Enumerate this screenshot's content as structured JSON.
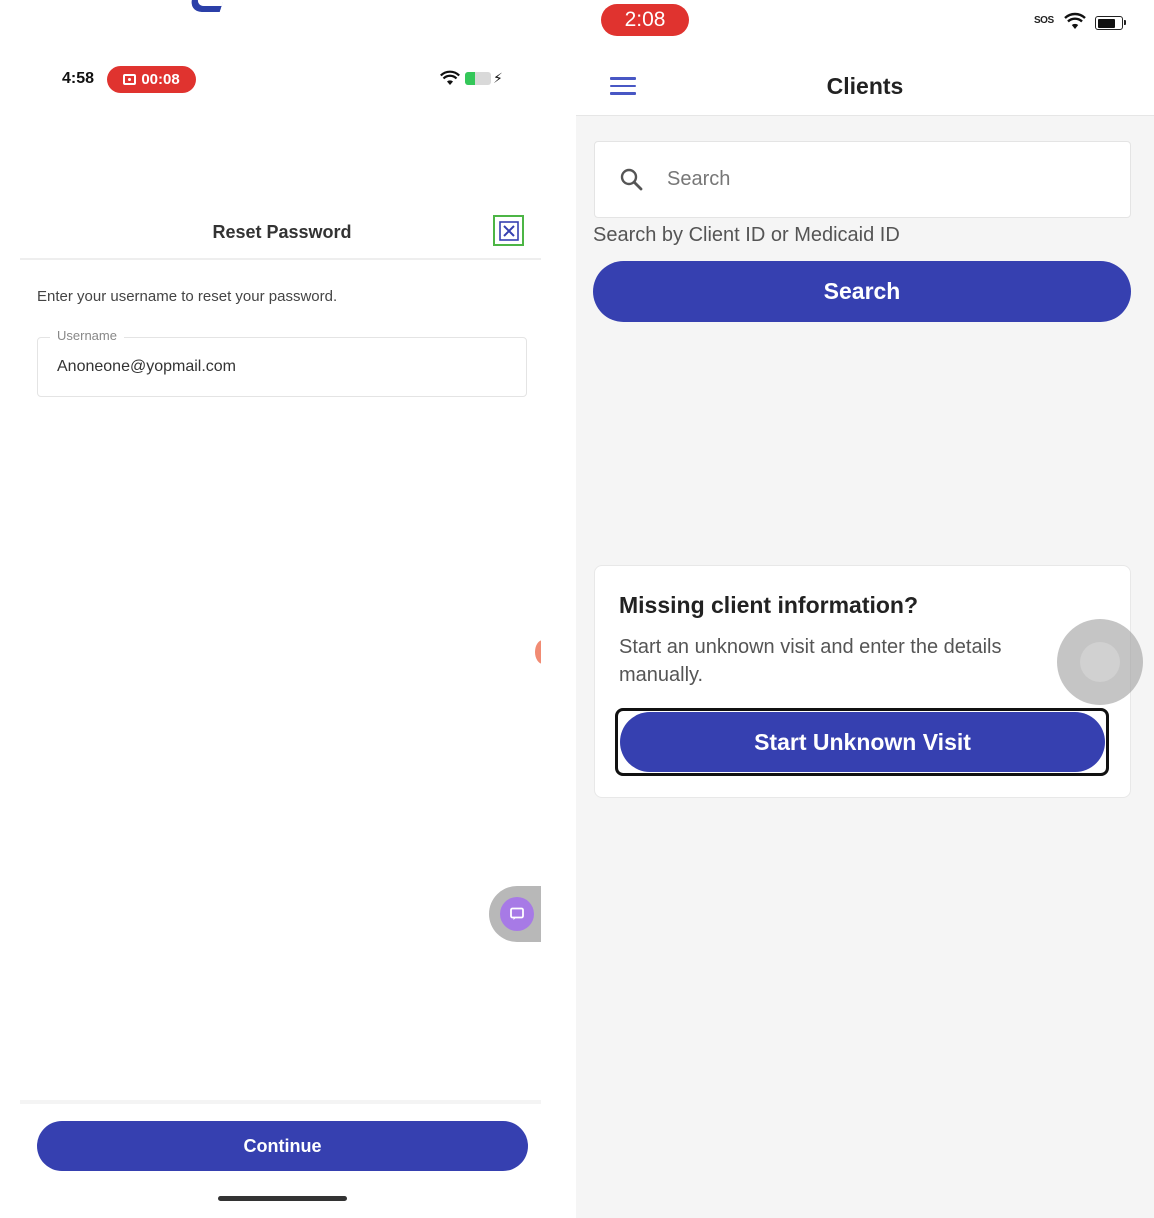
{
  "left_phone": {
    "status_bar": {
      "time": "4:58",
      "recording_time": "00:08"
    },
    "reset_password": {
      "title": "Reset Password",
      "instructions": "Enter your username to reset your password.",
      "username_label": "Username",
      "username_value": "Anoneone@yopmail.com",
      "continue_label": "Continue"
    },
    "colors": {
      "primary": "#3640b0",
      "close_border": "#4cb545",
      "recording": "#e0332f"
    }
  },
  "right_phone": {
    "status_bar": {
      "time": "2:08",
      "sos": "SOS"
    },
    "header": {
      "title": "Clients"
    },
    "search": {
      "placeholder": "Search",
      "hint": "Search by Client ID or Medicaid ID",
      "button_label": "Search"
    },
    "missing_info": {
      "title": "Missing client information?",
      "description": "Start an unknown visit and enter the details manually.",
      "button_label": "Start Unknown Visit"
    },
    "colors": {
      "primary": "#3640b0",
      "background": "#f5f5f5"
    }
  }
}
